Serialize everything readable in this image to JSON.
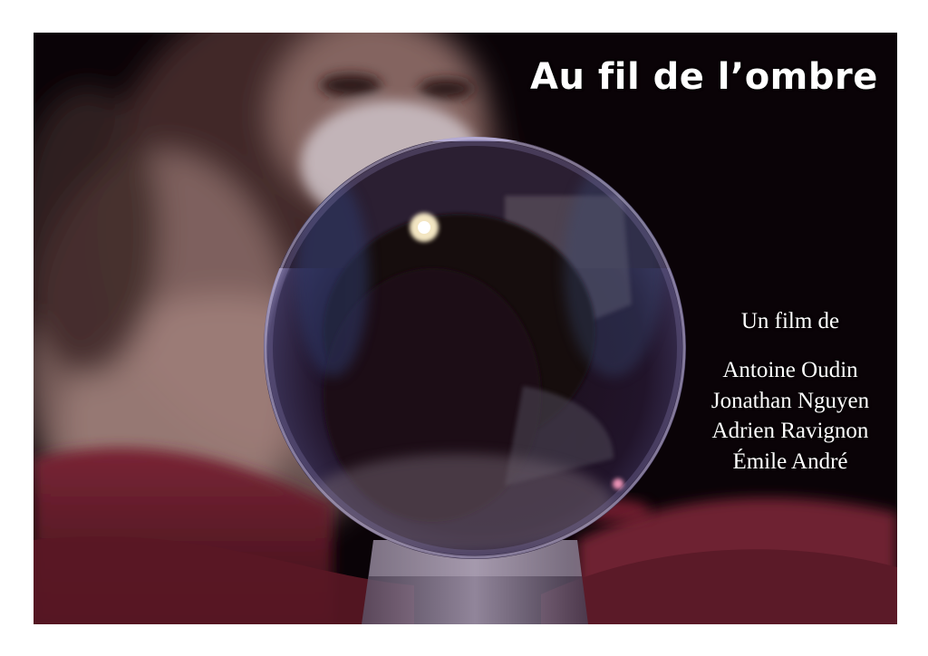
{
  "poster": {
    "title": "Au fil de l’ombre",
    "credit_intro": "Un film de",
    "directors": [
      "Antoine Oudin",
      "Jonathan Nguyen",
      "Adrien Ravignon",
      "Émile André"
    ],
    "colors": {
      "background": "#ffffff",
      "poster_dark": "#0b0408",
      "fabric": "#6a1e2c",
      "sphere_rim": "#b9a6d8",
      "text": "#ffffff"
    }
  }
}
